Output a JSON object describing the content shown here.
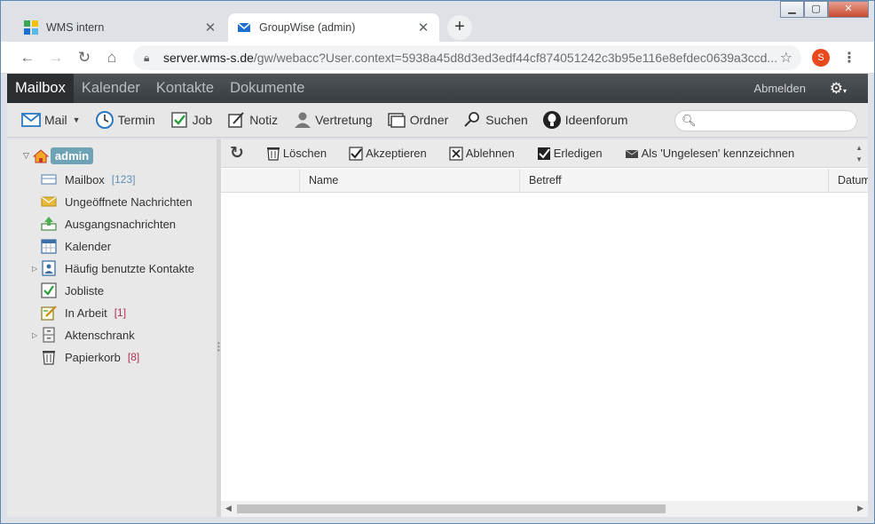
{
  "browser": {
    "tabs": [
      {
        "title": "WMS intern",
        "active": false
      },
      {
        "title": "GroupWise (admin)",
        "active": true
      }
    ],
    "url_host": "server.wms-s.de",
    "url_path": "/gw/webacc?User.context=5938a45d8d3ed3edf44cf874051242c3b95e116e8efdec0639a3ccd...",
    "profile_initial": "S"
  },
  "app": {
    "nav": [
      "Mailbox",
      "Kalender",
      "Kontakte",
      "Dokumente"
    ],
    "logout": "Abmelden",
    "toolbar": [
      {
        "label": "Mail",
        "icon": "envelope-icon",
        "dropdown": true
      },
      {
        "label": "Termin",
        "icon": "clock-icon"
      },
      {
        "label": "Job",
        "icon": "checkbox-icon"
      },
      {
        "label": "Notiz",
        "icon": "note-icon"
      },
      {
        "label": "Vertretung",
        "icon": "user-proxy-icon"
      },
      {
        "label": "Ordner",
        "icon": "folder-icon"
      },
      {
        "label": "Suchen",
        "icon": "find-icon"
      },
      {
        "label": "Ideenforum",
        "icon": "lightbulb-icon"
      }
    ],
    "search_placeholder": ""
  },
  "sidebar": {
    "root": "admin",
    "items": [
      {
        "label": "Mailbox",
        "count": "[123]",
        "count_color": "blue"
      },
      {
        "label": "Ungeöffnete Nachrichten",
        "count": ""
      },
      {
        "label": "Ausgangsnachrichten",
        "count": ""
      },
      {
        "label": "Kalender",
        "count": ""
      },
      {
        "label": "Häufig benutzte Kontakte",
        "count": "",
        "expandable": true
      },
      {
        "label": "Jobliste",
        "count": ""
      },
      {
        "label": "In Arbeit",
        "count": "[1]",
        "count_color": "red"
      },
      {
        "label": "Aktenschrank",
        "count": "",
        "expandable": true
      },
      {
        "label": "Papierkorb",
        "count": "[8]",
        "count_color": "red"
      }
    ]
  },
  "actions": [
    "Löschen",
    "Akzeptieren",
    "Ablehnen",
    "Erledigen",
    "Als 'Ungelesen' kennzeichnen"
  ],
  "columns": [
    "",
    "Name",
    "Betreff",
    "Datum"
  ]
}
